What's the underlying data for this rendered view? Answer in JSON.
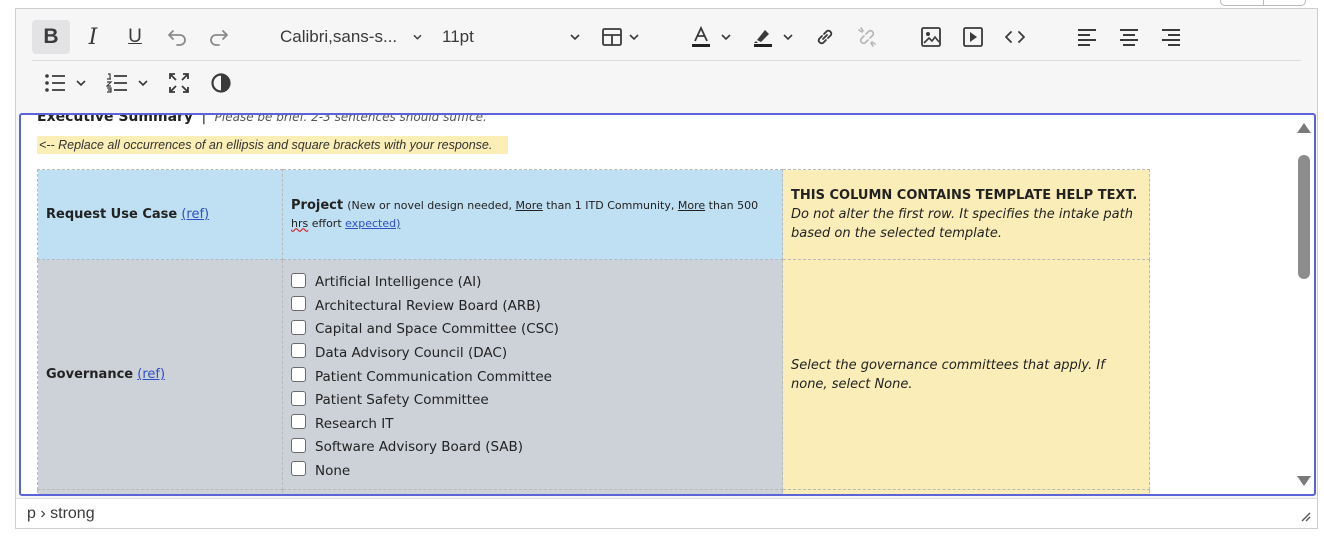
{
  "toolbar": {
    "font_family": "Calibri,sans-s...",
    "font_size": "11pt",
    "buttons": {
      "bold": "B",
      "italic": "I",
      "underline": "U"
    }
  },
  "document": {
    "exec_heading": "Executive Summary",
    "exec_separator": "|",
    "exec_hint": "Please be brief. 2-3 sentences should suffice.",
    "replace_hint": "<-- Replace all occurrences of an ellipsis and square brackets with your response.",
    "table": {
      "row1": {
        "label": "Request Use Case",
        "ref": "(ref)",
        "project_title": "Project",
        "project_note_a": "(New or novel design needed, ",
        "project_more1": "More",
        "project_note_b": " than 1 ITD Community, ",
        "project_more2": "More",
        "project_note_c": " than 500 ",
        "project_hrs": "hrs",
        "project_note_d": " effort ",
        "project_expected": "expected)",
        "help_head": "THIS COLUMN CONTAINS TEMPLATE HELP TEXT.",
        "help_body": "Do not alter the first row. It specifies the intake path based on the selected template."
      },
      "row2": {
        "label": "Governance",
        "ref": "(ref)",
        "checkboxes": [
          "Artificial Intelligence (AI)",
          "Architectural Review Board (ARB)",
          "Capital and Space Committee (CSC)",
          "Data Advisory Council (DAC)",
          "Patient Communication Committee",
          "Patient Safety Committee",
          "Research IT",
          "Software Advisory Board (SAB)",
          "None"
        ],
        "help": "Select the governance committees that apply. If none, select None."
      }
    }
  },
  "statusbar": {
    "path": "p › strong"
  },
  "colors": {
    "focus_border": "#5a63d8",
    "blue_cell": "#bfdff2",
    "grey_cell": "#cdd1d8",
    "yellow_cell": "#faedb8",
    "link": "#2f4fc4"
  }
}
